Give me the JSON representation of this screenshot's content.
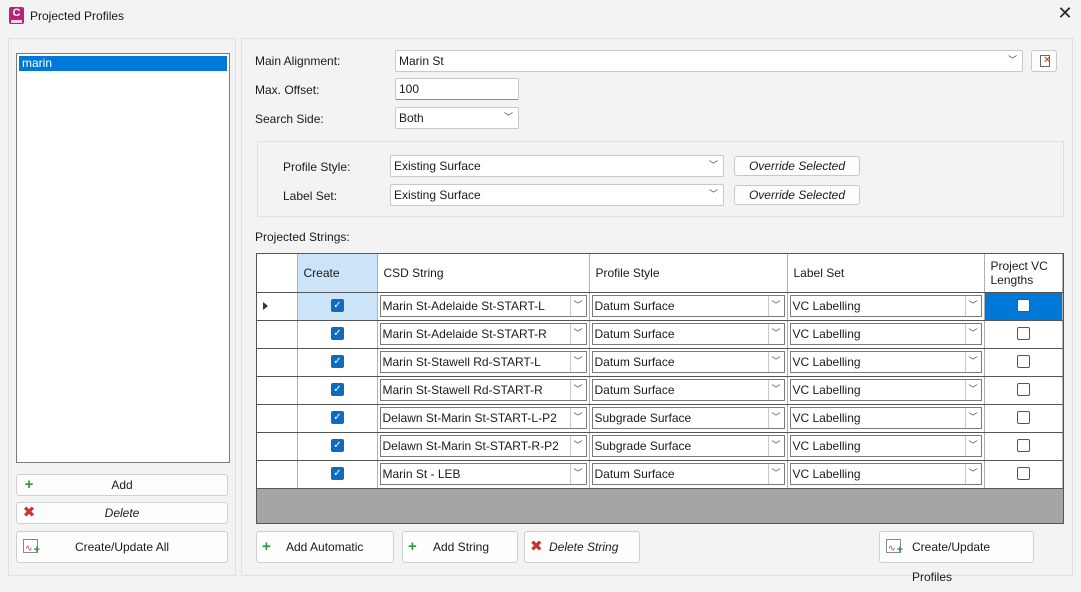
{
  "window": {
    "title": "Projected Profiles",
    "close_glyph": "✕"
  },
  "profiles_list": {
    "items": [
      "marin"
    ],
    "selected_index": 0
  },
  "left_buttons": {
    "add": "Add",
    "delete": "Delete",
    "create_update_all": "Create/Update All"
  },
  "form": {
    "main_alignment_label": "Main Alignment:",
    "main_alignment_value": "Marin St",
    "max_offset_label": "Max. Offset:",
    "max_offset_value": "100",
    "search_side_label": "Search Side:",
    "search_side_value": "Both"
  },
  "style_group": {
    "profile_style_label": "Profile Style:",
    "profile_style_value": "Existing Surface",
    "label_set_label": "Label Set:",
    "label_set_value": "Existing Surface",
    "override_label": "Override Selected"
  },
  "grid": {
    "section_label": "Projected Strings:",
    "columns": [
      "Create",
      "CSD String",
      "Profile Style",
      "Label Set",
      "Project VC Lengths"
    ],
    "rows": [
      {
        "create": true,
        "csd": "Marin St-Adelaide St-START-L",
        "profile_style": "Datum Surface",
        "label_set": "VC Labelling",
        "vc": false
      },
      {
        "create": true,
        "csd": "Marin St-Adelaide St-START-R",
        "profile_style": "Datum Surface",
        "label_set": "VC Labelling",
        "vc": false
      },
      {
        "create": true,
        "csd": "Marin St-Stawell Rd-START-L",
        "profile_style": "Datum Surface",
        "label_set": "VC Labelling",
        "vc": false
      },
      {
        "create": true,
        "csd": "Marin St-Stawell Rd-START-R",
        "profile_style": "Datum Surface",
        "label_set": "VC Labelling",
        "vc": false
      },
      {
        "create": true,
        "csd": "Delawn St-Marin St-START-L-P2",
        "profile_style": "Subgrade Surface",
        "label_set": "VC Labelling",
        "vc": false
      },
      {
        "create": true,
        "csd": "Delawn St-Marin St-START-R-P2",
        "profile_style": "Subgrade Surface",
        "label_set": "VC Labelling",
        "vc": false
      },
      {
        "create": true,
        "csd": "Marin St - LEB",
        "profile_style": "Datum Surface",
        "label_set": "VC Labelling",
        "vc": false
      }
    ],
    "current_row": 0
  },
  "bottom_buttons": {
    "add_automatic": "Add Automatic",
    "add_string": "Add String",
    "delete_string": "Delete String",
    "create_update_profiles": "Create/Update Profiles"
  },
  "icons": {
    "app": "civil3d-app-icon",
    "add": "plus-icon",
    "delete": "red-x-icon",
    "create_update": "profile-create-icon",
    "pick": "pick-alignment-icon"
  },
  "colors": {
    "accent": "#0078d7",
    "selected_header": "#cce4f7",
    "check": "#0f6cbd"
  }
}
